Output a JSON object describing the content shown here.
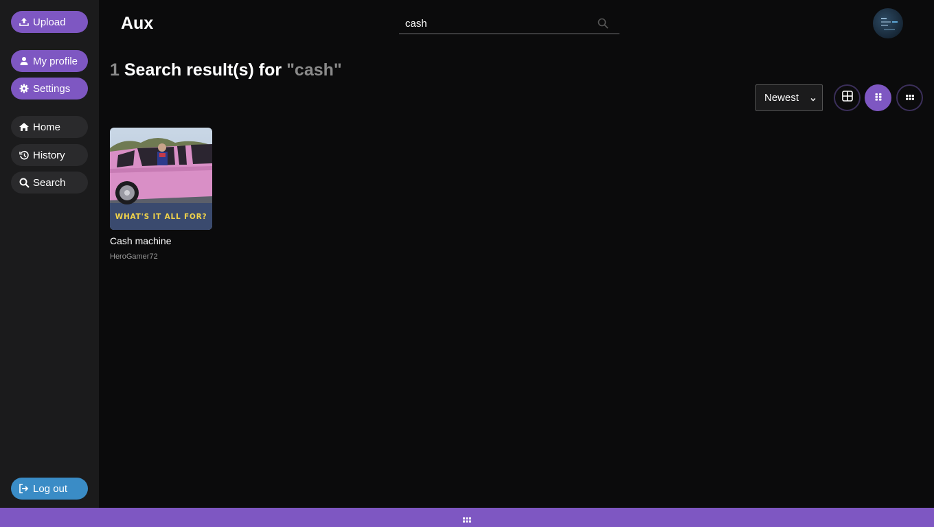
{
  "sidebar": {
    "upload": "Upload",
    "my_profile": "My profile",
    "settings": "Settings",
    "home": "Home",
    "history": "History",
    "search": "Search",
    "logout": "Log out"
  },
  "header": {
    "logo": "Aux",
    "search_value": "cash"
  },
  "results": {
    "count": "1",
    "label": "Search result(s) for",
    "query": "\"cash\""
  },
  "sort": {
    "selected": "Newest"
  },
  "items": [
    {
      "title": "Cash machine",
      "author": "HeroGamer72",
      "cover_text": "WHAT'S IT ALL FOR?"
    }
  ],
  "colors": {
    "accent": "#7e57c2",
    "logout": "#3a8cc6",
    "background": "#0b0b0c",
    "sidebar": "#1b1b1c"
  }
}
